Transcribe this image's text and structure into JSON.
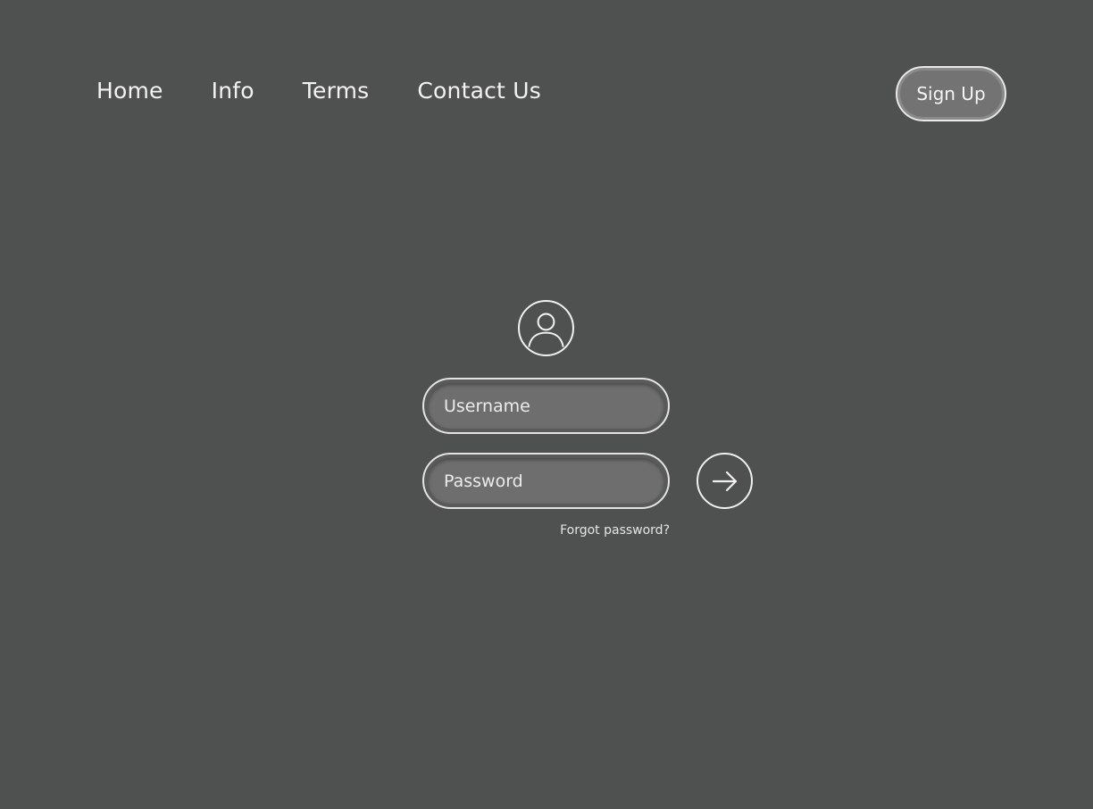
{
  "nav": {
    "items": [
      {
        "label": "Home"
      },
      {
        "label": "Info"
      },
      {
        "label": "Terms"
      },
      {
        "label": "Contact Us"
      }
    ],
    "signup_label": "Sign Up"
  },
  "login": {
    "avatar_icon": "user-icon",
    "username": {
      "placeholder": "Username",
      "value": ""
    },
    "password": {
      "placeholder": "Password",
      "value": ""
    },
    "submit_icon": "arrow-right-icon",
    "forgot_label": "Forgot password?"
  },
  "colors": {
    "background": "#4f5050",
    "field_fill": "#6e6e6e",
    "outline": "#f0f0f0",
    "text": "#f3f3f3"
  }
}
